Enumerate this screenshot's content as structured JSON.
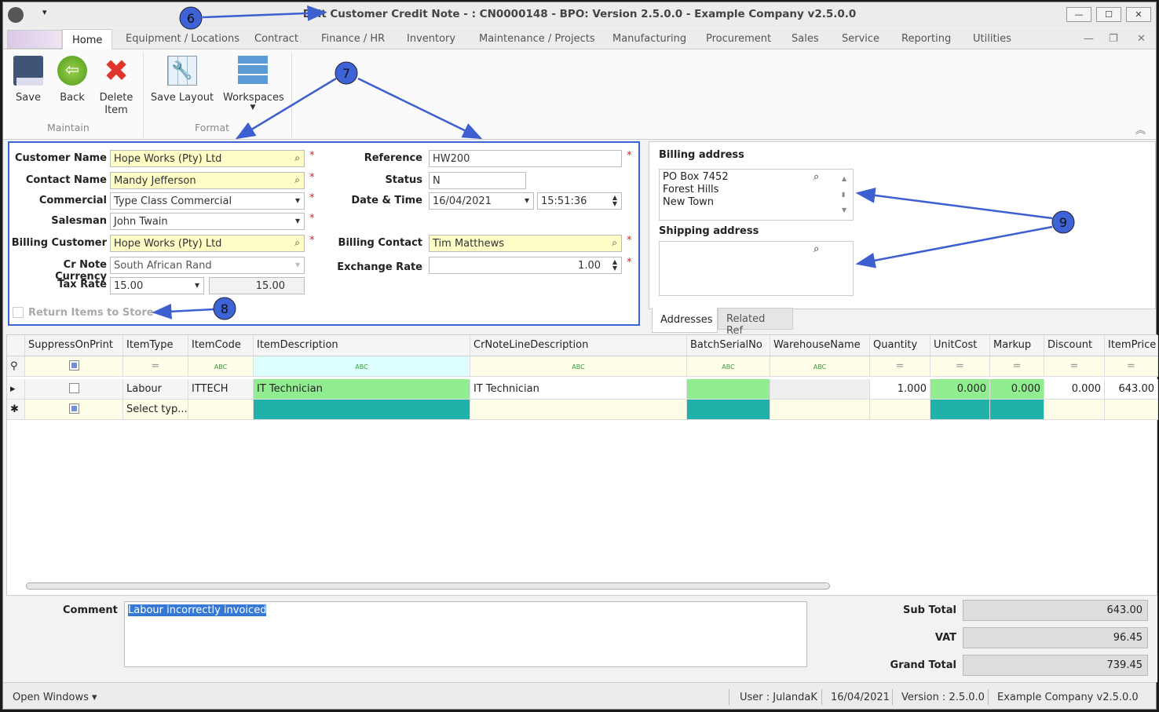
{
  "window": {
    "title": "Edit Customer Credit Note - : CN0000148 - BPO: Version 2.5.0.0 - Example Company v2.5.0.0",
    "controls": [
      "—",
      "☐",
      "✕"
    ]
  },
  "menu_tabs": [
    "Home",
    "Equipment / Locations",
    "Contract",
    "Finance / HR",
    "Inventory",
    "Maintenance / Projects",
    "Manufacturing",
    "Procurement",
    "Sales",
    "Service",
    "Reporting",
    "Utilities"
  ],
  "ribbon": {
    "save": "Save",
    "back": "Back",
    "delete": "Delete Item",
    "save_layout": "Save Layout",
    "workspaces": "Workspaces",
    "group_maintain": "Maintain",
    "group_format": "Format"
  },
  "form": {
    "customer_name": {
      "label": "Customer Name",
      "value": "Hope Works (Pty) Ltd"
    },
    "contact_name": {
      "label": "Contact Name",
      "value": "Mandy Jefferson"
    },
    "commercial": {
      "label": "Commercial",
      "value": "Type Class Commercial"
    },
    "salesman": {
      "label": "Salesman",
      "value": "John Twain"
    },
    "billing_customer": {
      "label": "Billing Customer",
      "value": "Hope Works (Pty) Ltd"
    },
    "currency": {
      "label": "Cr Note Currency",
      "value": "South African Rand"
    },
    "tax_rate": {
      "label": "Tax Rate",
      "value": "15.00",
      "value2": "15.00"
    },
    "return_items": {
      "label": "Return Items to Store"
    },
    "reference": {
      "label": "Reference",
      "value": "HW200"
    },
    "status": {
      "label": "Status",
      "value": "N"
    },
    "date_time": {
      "label": "Date & Time",
      "date": "16/04/2021",
      "time": "15:51:36"
    },
    "billing_contact": {
      "label": "Billing Contact",
      "value": "Tim  Matthews"
    },
    "exchange_rate": {
      "label": "Exchange Rate",
      "value": "1.00"
    },
    "required": "*"
  },
  "address": {
    "billing_label": "Billing address",
    "billing_lines": [
      "PO Box 7452",
      "Forest Hills",
      "New Town"
    ],
    "shipping_label": "Shipping address",
    "tabs": [
      "Addresses",
      "Related Ref"
    ]
  },
  "grid": {
    "columns": [
      "SuppressOnPrint",
      "ItemType",
      "ItemCode",
      "ItemDescription",
      "CrNoteLineDescription",
      "BatchSerialNo",
      "WarehouseName",
      "Quantity",
      "UnitCost",
      "Markup",
      "Discount",
      "ItemPrice"
    ],
    "filter_abc": "ABC",
    "filter_eq": "=",
    "rows": [
      {
        "item_type": "Labour",
        "item_code": "ITTECH",
        "item_description": "IT Technician",
        "line_description": "IT Technician",
        "quantity": "1.000",
        "unit_cost": "0.000",
        "markup": "0.000",
        "discount": "0.000",
        "item_price": "643.00"
      }
    ],
    "new_row": {
      "item_type": "Select typ..."
    }
  },
  "bottom": {
    "comment_label": "Comment",
    "comment": "Labour incorrectly invoiced",
    "sub_total_label": "Sub Total",
    "sub_total": "643.00",
    "vat_label": "VAT",
    "vat": "96.45",
    "grand_total_label": "Grand Total",
    "grand_total": "739.45"
  },
  "status_bar": {
    "open_windows": "Open Windows ▾",
    "user": "User : JulandaK",
    "date": "16/04/2021",
    "version": "Version : 2.5.0.0",
    "company": "Example Company v2.5.0.0"
  },
  "annotations": [
    "6",
    "7",
    "8",
    "9"
  ],
  "colors": {
    "accent": "#3d63d6",
    "required": "#e02020",
    "highlight_green": "#90ee90",
    "teal": "#20b2aa",
    "yellow": "#fdfdc5"
  }
}
